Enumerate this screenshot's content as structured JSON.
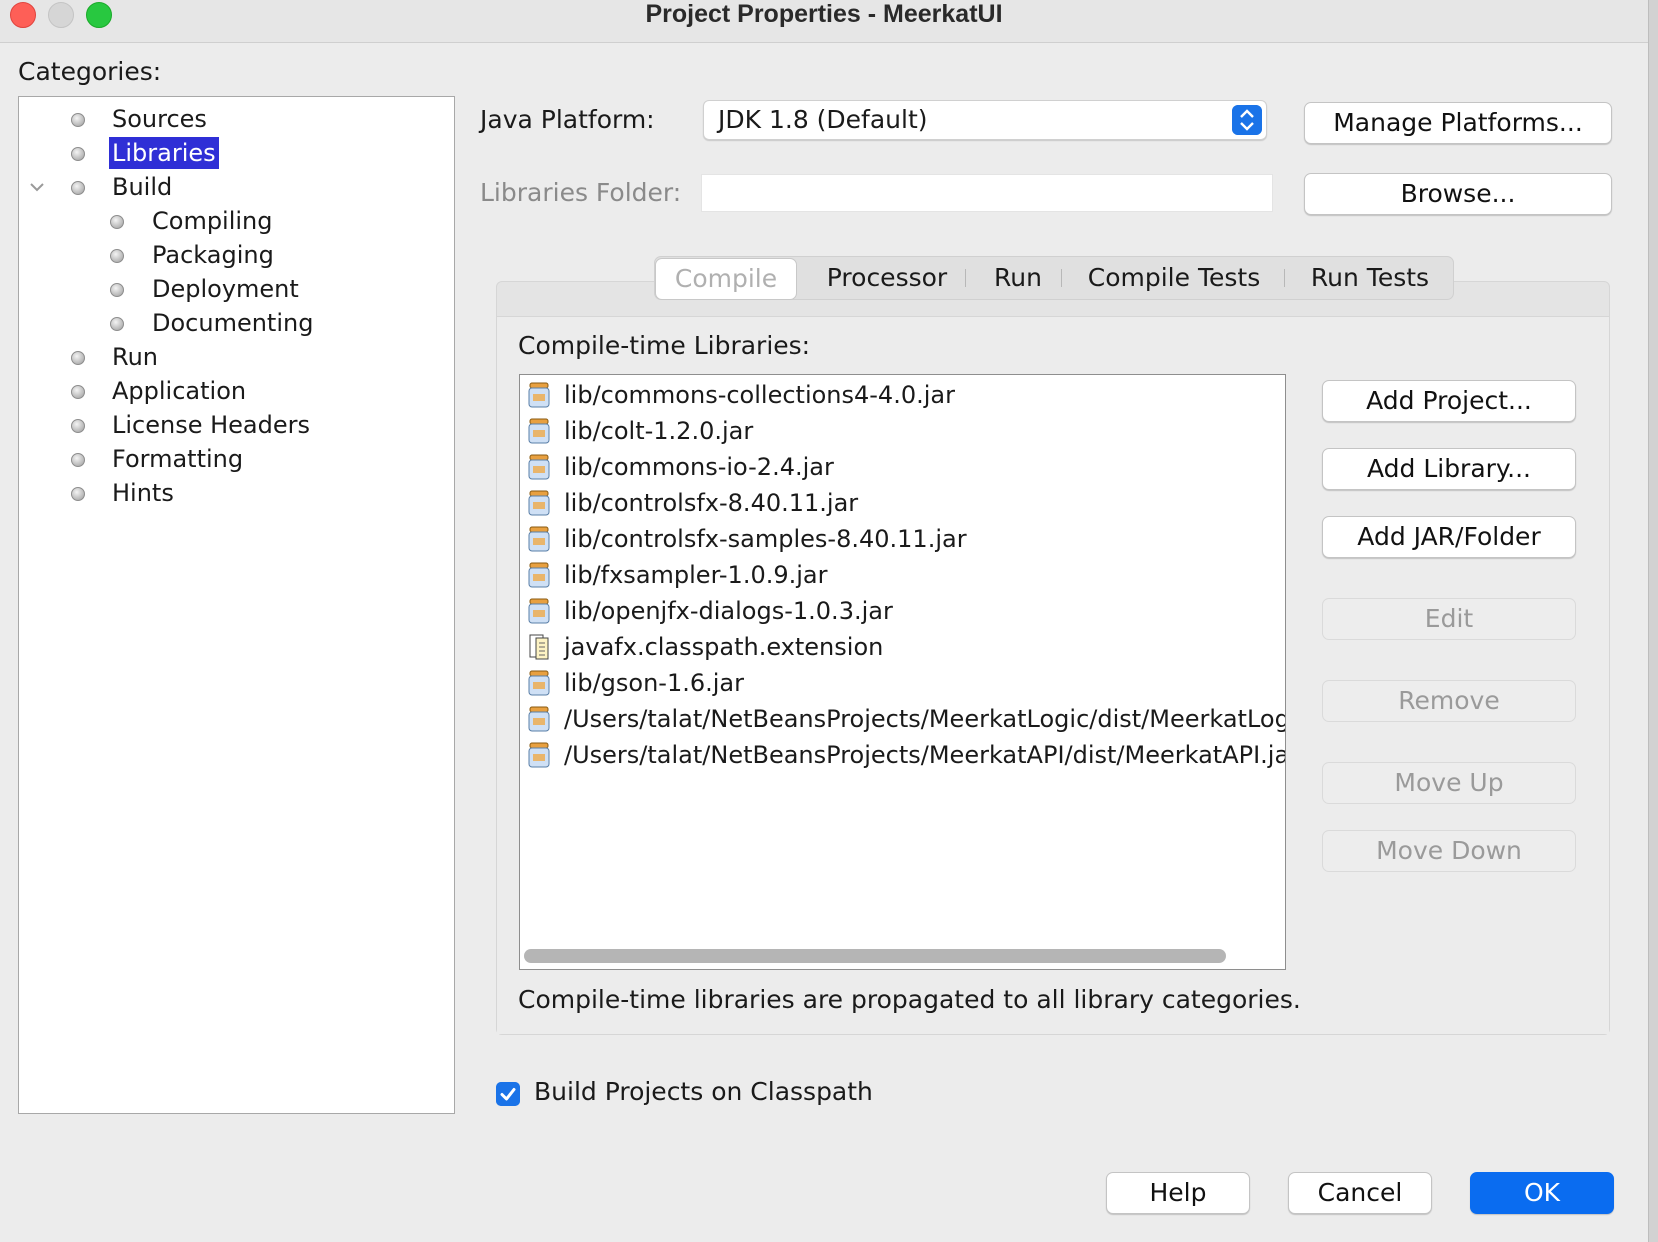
{
  "window": {
    "title": "Project Properties - MeerkatUI",
    "traffic_lights": [
      "close",
      "minimize",
      "zoom"
    ],
    "colors": {
      "close": "#fe5f57",
      "minimize": "#d6d6d6",
      "zoom": "#28c840"
    }
  },
  "categories": {
    "label": "Categories:",
    "items": [
      {
        "label": "Sources"
      },
      {
        "label": "Libraries",
        "selected": true
      },
      {
        "label": "Build",
        "expanded": true
      },
      {
        "label": "Compiling"
      },
      {
        "label": "Packaging"
      },
      {
        "label": "Deployment"
      },
      {
        "label": "Documenting"
      },
      {
        "label": "Run"
      },
      {
        "label": "Application"
      },
      {
        "label": "License Headers"
      },
      {
        "label": "Formatting"
      },
      {
        "label": "Hints"
      }
    ]
  },
  "java_platform": {
    "label": "Java Platform:",
    "value": "JDK 1.8 (Default)",
    "manage_button": "Manage Platforms..."
  },
  "libraries_folder": {
    "label": "Libraries Folder:",
    "value": "",
    "browse_button": "Browse..."
  },
  "tabs": [
    {
      "label": "Compile",
      "selected": true
    },
    {
      "label": "Processor"
    },
    {
      "label": "Run"
    },
    {
      "label": "Compile Tests"
    },
    {
      "label": "Run Tests"
    }
  ],
  "compile": {
    "list_label": "Compile-time Libraries:",
    "items": [
      {
        "text": "lib/commons-collections4-4.0.jar",
        "icon": "jar-icon"
      },
      {
        "text": "lib/colt-1.2.0.jar",
        "icon": "jar-icon"
      },
      {
        "text": "lib/commons-io-2.4.jar",
        "icon": "jar-icon"
      },
      {
        "text": "lib/controlsfx-8.40.11.jar",
        "icon": "jar-icon"
      },
      {
        "text": "lib/controlsfx-samples-8.40.11.jar",
        "icon": "jar-icon"
      },
      {
        "text": "lib/fxsampler-1.0.9.jar",
        "icon": "jar-icon"
      },
      {
        "text": "lib/openjfx-dialogs-1.0.3.jar",
        "icon": "jar-icon"
      },
      {
        "text": "javafx.classpath.extension",
        "icon": "classpath-icon"
      },
      {
        "text": "lib/gson-1.6.jar",
        "icon": "jar-icon"
      },
      {
        "text": "/Users/talat/NetBeansProjects/MeerkatLogic/dist/MeerkatLogi",
        "icon": "jar-icon"
      },
      {
        "text": "/Users/talat/NetBeansProjects/MeerkatAPI/dist/MeerkatAPI.ja",
        "icon": "jar-icon"
      }
    ],
    "buttons": {
      "add_project": "Add Project...",
      "add_library": "Add Library...",
      "add_jar": "Add JAR/Folder",
      "edit": "Edit",
      "remove": "Remove",
      "move_up": "Move Up",
      "move_down": "Move Down"
    },
    "note": "Compile-time libraries are propagated to all library categories."
  },
  "build_on_classpath": {
    "label": "Build Projects on Classpath",
    "checked": true
  },
  "footer": {
    "help": "Help",
    "cancel": "Cancel",
    "ok": "OK"
  },
  "colors": {
    "accent": "#0a6cf0",
    "selection": "#2f2fd6"
  }
}
